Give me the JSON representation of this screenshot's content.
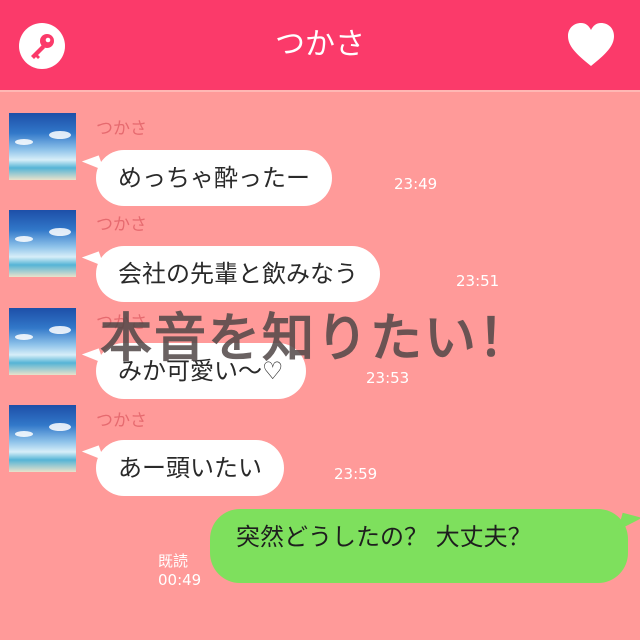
{
  "header": {
    "title": "つかさ",
    "left_icon": "key-icon",
    "right_icon": "heart-icon"
  },
  "colors": {
    "header": "#fb3a6a",
    "background": "#ff9a99",
    "incoming_bubble": "#ffffff",
    "outgoing_bubble": "#7ee05d"
  },
  "messages": [
    {
      "sender": "つかさ",
      "text": "めっちゃ酔ったー",
      "time": "23:49"
    },
    {
      "sender": "つかさ",
      "text": "会社の先輩と飲みなう",
      "time": "23:51"
    },
    {
      "sender": "つかさ",
      "text": "みか可愛い〜♡",
      "time": "23:53"
    },
    {
      "sender": "つかさ",
      "text": "あー頭いたい",
      "time": "23:59"
    }
  ],
  "reply": {
    "text": "突然どうしたの？ 大丈夫？",
    "read_label": "既読",
    "time": "00:49"
  },
  "overlay_text": "本音を知りたい！"
}
